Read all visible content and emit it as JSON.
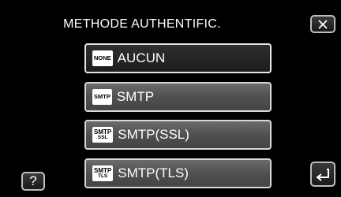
{
  "header": {
    "title": "METHODE AUTHENTIFIC."
  },
  "buttons": {
    "close": "✕",
    "help": "?",
    "back": "⮌"
  },
  "menu": {
    "items": [
      {
        "label": "AUCUN",
        "badge_line1": "NONE",
        "badge_line2": "",
        "selected": true
      },
      {
        "label": "SMTP",
        "badge_line1": "SMTP",
        "badge_line2": "",
        "selected": false
      },
      {
        "label": "SMTP(SSL)",
        "badge_line1": "SMTP",
        "badge_line2": "SSL",
        "selected": false
      },
      {
        "label": "SMTP(TLS)",
        "badge_line1": "SMTP",
        "badge_line2": "TLS",
        "selected": false
      }
    ]
  }
}
